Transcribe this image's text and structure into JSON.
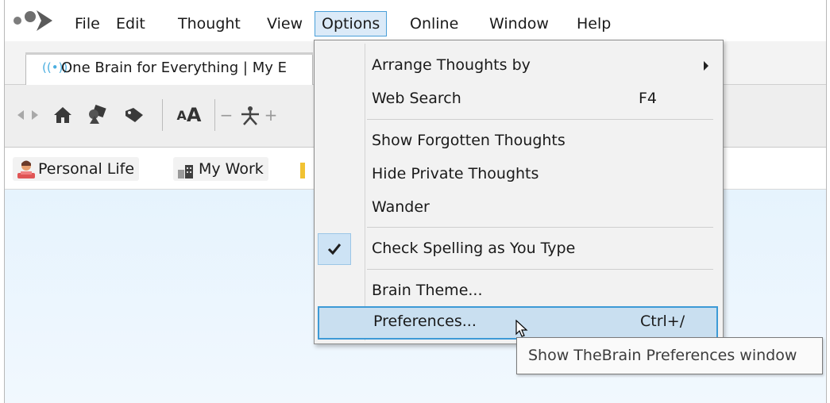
{
  "menubar": {
    "logo": "brain-logo-icon",
    "items": [
      {
        "label": "File"
      },
      {
        "label": "Edit"
      },
      {
        "label": "Thought"
      },
      {
        "label": "View"
      },
      {
        "label": "Options"
      },
      {
        "label": "Online"
      },
      {
        "label": "Window"
      },
      {
        "label": "Help"
      }
    ],
    "open_menu": "Options"
  },
  "tab": {
    "label": "One Brain for Everything | My E",
    "icon": "broadcast-icon"
  },
  "toolbar": {
    "icons": [
      "back-icon",
      "forward-icon",
      "home-icon",
      "thought-types-icon",
      "tags-icon",
      "font-size-icon",
      "zoom-out-icon",
      "layout-icon",
      "zoom-in-icon"
    ],
    "font_size_label": "AA"
  },
  "pins": [
    {
      "label": "Personal Life",
      "icon": "person-icon"
    },
    {
      "label": "My Work",
      "icon": "buildings-icon"
    }
  ],
  "options_menu": {
    "items": [
      {
        "label": "Arrange Thoughts by",
        "submenu": true
      },
      {
        "label": "Web Search",
        "shortcut": "F4"
      },
      {
        "label": "Show Forgotten Thoughts"
      },
      {
        "label": "Hide Private Thoughts"
      },
      {
        "label": "Wander"
      },
      {
        "label": "Check Spelling as You Type",
        "checked": true
      },
      {
        "label": "Brain Theme..."
      },
      {
        "label": "Preferences...",
        "shortcut": "Ctrl+/",
        "highlighted": true
      }
    ]
  },
  "tooltip": {
    "text": "Show TheBrain Preferences window"
  },
  "colors": {
    "menu_highlight": "#c9dff0",
    "menu_highlight_border": "#3d9ad6",
    "plex_background": "#e6f3fd"
  }
}
